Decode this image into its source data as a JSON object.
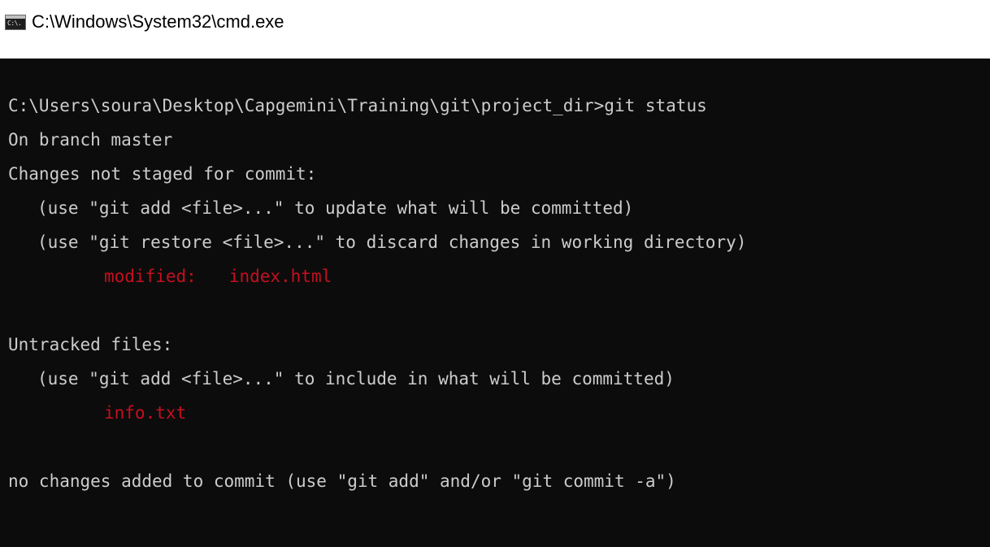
{
  "window": {
    "title": "C:\\Windows\\System32\\cmd.exe",
    "icon": "cmd-console-icon",
    "icon_text": "C:\\."
  },
  "console": {
    "colors": {
      "background": "#0c0c0c",
      "text": "#cccccc",
      "highlight": "#c50f1f"
    },
    "prompt": "C:\\Users\\soura\\Desktop\\Capgemini\\Training\\git\\project_dir>git status",
    "branch_line": "On branch master",
    "unstaged_header": "Changes not staged for commit:",
    "unstaged_hint_1": "(use \"git add <file>...\" to update what will be committed)",
    "unstaged_hint_2": "(use \"git restore <file>...\" to discard changes in working directory)",
    "modified_label": "modified:",
    "modified_file": "index.html",
    "untracked_header": "Untracked files:",
    "untracked_hint": "(use \"git add <file>...\" to include in what will be committed)",
    "untracked_file": "info.txt",
    "summary": "no changes added to commit (use \"git add\" and/or \"git commit -a\")"
  }
}
